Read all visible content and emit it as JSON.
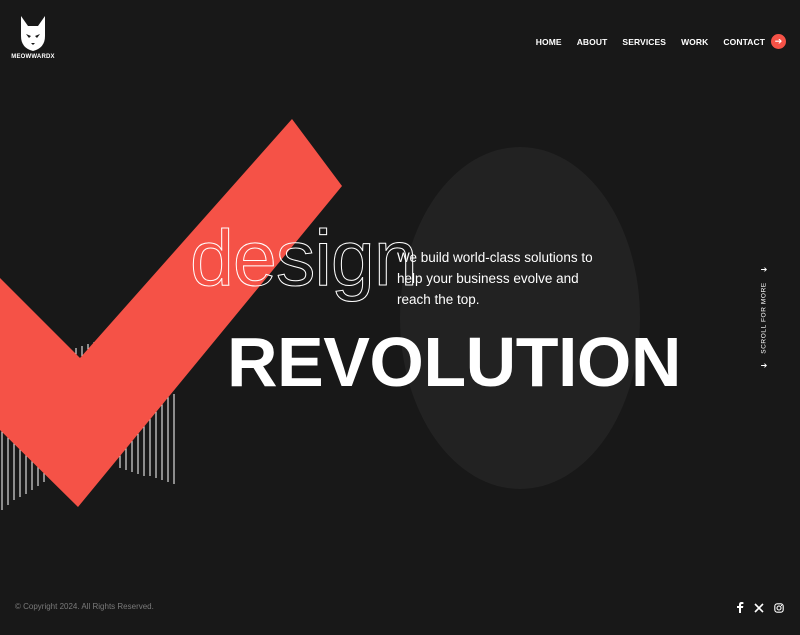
{
  "brand": {
    "name": "MEOWWARDX"
  },
  "nav": {
    "items": [
      {
        "label": "HOME"
      },
      {
        "label": "ABOUT"
      },
      {
        "label": "SERVICES"
      },
      {
        "label": "WORK"
      },
      {
        "label": "CONTACT"
      }
    ],
    "cta_icon": "arrow-right-icon"
  },
  "hero": {
    "outline_word": "design",
    "headline": "REVOLUTION",
    "tagline": "We build world-class solutions to help your business evolve and reach the top."
  },
  "scroll": {
    "label": "SCROLL FOR MORE",
    "icon": "arrow-right-icon"
  },
  "footer": {
    "copyright": "© Copyright 2024. All Rights Reserved."
  },
  "social": [
    "facebook-icon",
    "x-icon",
    "instagram-icon"
  ],
  "colors": {
    "accent": "#f55247",
    "background": "#181818",
    "circle": "#222222",
    "text": "#ffffff"
  }
}
